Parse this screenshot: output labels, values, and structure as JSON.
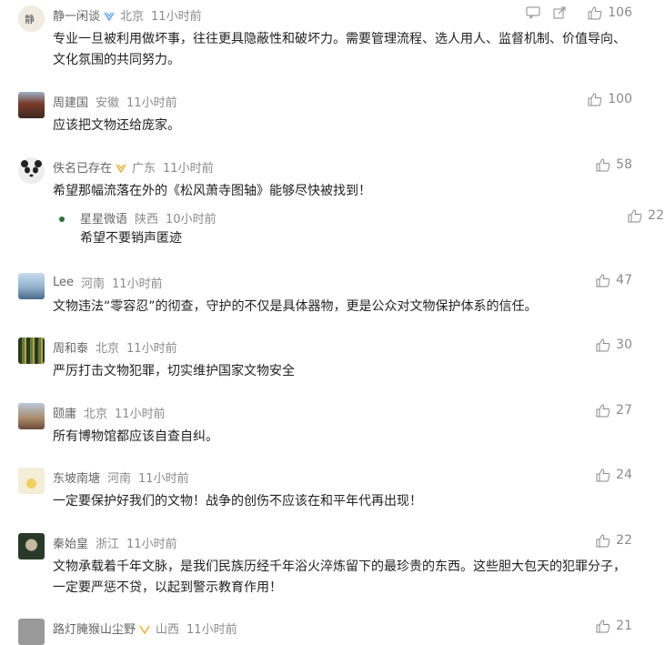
{
  "comments": [
    {
      "name": "静一闲谈",
      "location": "北京",
      "time": "11小时前",
      "likes": "106",
      "text": "专业一旦被利用做坏事，往往更具隐蔽性和破坏力。需要管理流程、选人用人、监督机制、价值导向、文化氛围的共同努力。",
      "avatar_color": "#e9e4d8",
      "badge_color": "#6aa6e8"
    },
    {
      "name": "周建国",
      "location": "安徽",
      "time": "11小时前",
      "likes": "100",
      "text": "应该把文物还给庞家。",
      "avatar_color": "#7a3b2a"
    },
    {
      "name": "佚名已存在",
      "location": "广东",
      "time": "11小时前",
      "likes": "58",
      "text": "希望那幅流落在外的《松风萧寺图轴》能够尽快被找到！",
      "avatar_color": "#d8d8d8",
      "badge_color": "#e8b33a",
      "reply": {
        "name": "星星微语",
        "location": "陕西",
        "time": "10小时前",
        "likes": "22",
        "text": "希望不要销声匿迹",
        "avatar_color": "#2f6e3a"
      }
    },
    {
      "name": "Lee",
      "location": "河南",
      "time": "11小时前",
      "likes": "47",
      "text": "文物违法“零容忍”的彻查，守护的不仅是具体器物，更是公众对文物保护体系的信任。",
      "avatar_color": "#7ea7c9"
    },
    {
      "name": "周和泰",
      "location": "北京",
      "time": "11小时前",
      "likes": "30",
      "text": "严厉打击文物犯罪，切实维护国家文物安全",
      "avatar_color": "#5a6a3a"
    },
    {
      "name": "颐庸",
      "location": "北京",
      "time": "11小时前",
      "likes": "27",
      "text": "所有博物馆都应该自查自纠。",
      "avatar_color": "#a8b8c8"
    },
    {
      "name": "东坡南塘",
      "location": "河南",
      "time": "11小时前",
      "likes": "24",
      "text": "一定要保护好我们的文物！战争的创伤不应该在和平年代再出现！",
      "avatar_color": "#e8d890"
    },
    {
      "name": "秦始皇",
      "location": "浙江",
      "time": "11小时前",
      "likes": "22",
      "text": "文物承载着千年文脉，是我们民族历经千年浴火淬炼留下的最珍贵的东西。这些胆大包天的犯罪分子，一定要严惩不贷，以起到警示教育作用！",
      "avatar_color": "#2a3a2a"
    },
    {
      "name": "路灯腌猴山尘野",
      "location": "山西",
      "time": "11小时前",
      "likes": "21",
      "text": "",
      "avatar_color": "#999999"
    }
  ]
}
